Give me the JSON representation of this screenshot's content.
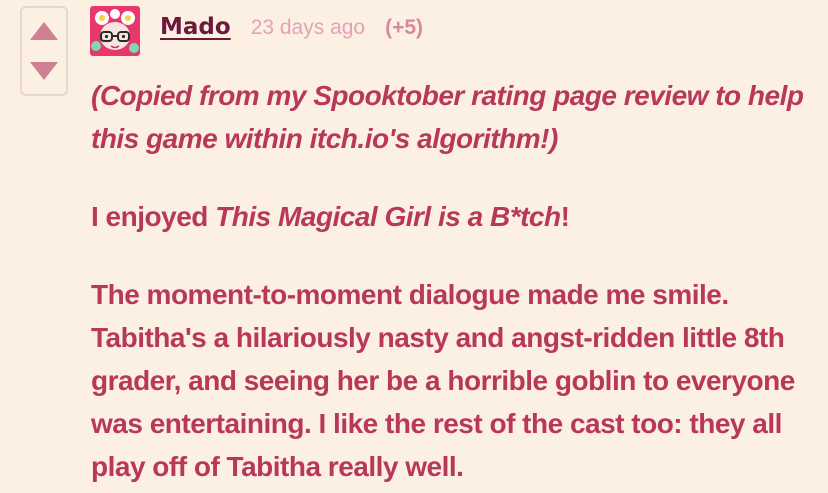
{
  "comment": {
    "author": "Mado",
    "time": "23 days ago",
    "score": "(+5)",
    "paragraph1": "(Copied from my Spooktober rating page review to help this game within itch.io's algorithm!)",
    "paragraph2": {
      "prefix": "I enjoyed ",
      "title": "This Magical Girl is a B*tch",
      "suffix": "!"
    },
    "paragraph3": "The moment-to-moment dialogue made me smile. Tabitha's a hilariously nasty and angst-ridden little 8th grader, and seeing her be a horrible goblin to everyone was entertaining. I like the rest of the cast too: they all play off of Tabitha really well."
  },
  "icons": {
    "upvote": "triangle-up-icon",
    "downvote": "triangle-down-icon"
  },
  "colors": {
    "background": "#fcf0e3",
    "text": "#b8385a",
    "author": "#6b1a3c",
    "muted": "#e5a2b6",
    "vote_arrow": "#cf8093",
    "avatar_bg": "#e8376f"
  }
}
